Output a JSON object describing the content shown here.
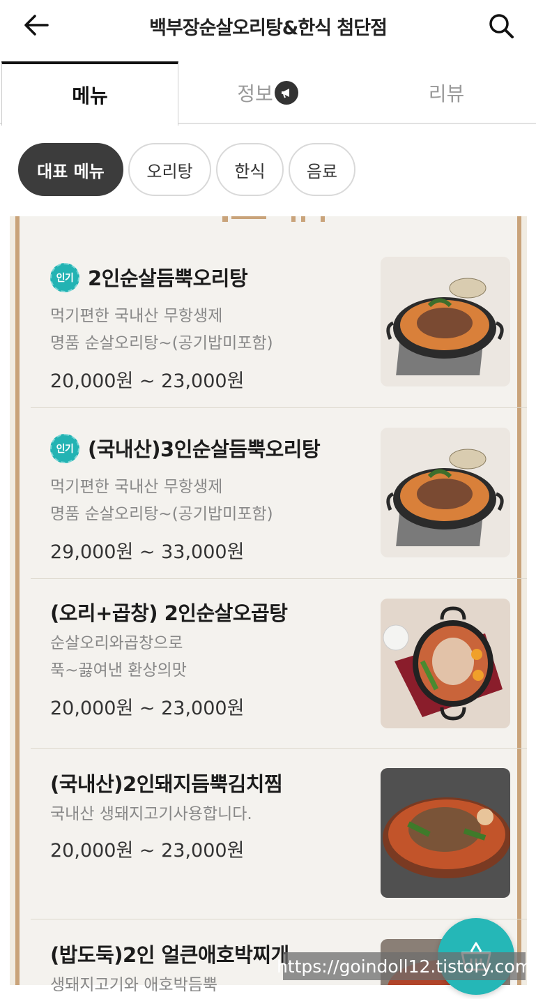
{
  "header": {
    "title": "백부장순살오리탕&한식 첨단점",
    "back_icon": "arrow-left-icon",
    "search_icon": "search-icon"
  },
  "tabs": [
    {
      "label": "메뉴",
      "active": true
    },
    {
      "label": "정보",
      "icon": "megaphone-icon"
    },
    {
      "label": "리뷰"
    }
  ],
  "chips": [
    {
      "label": "대표 메뉴",
      "active": true
    },
    {
      "label": "오리탕"
    },
    {
      "label": "한식"
    },
    {
      "label": "음료"
    }
  ],
  "badge_label": "인기",
  "items": [
    {
      "name": "2인순살듬뿍오리탕",
      "popular": true,
      "desc1": "먹기편한 국내산 무항생제",
      "desc2": "명품 순살오리탕~(공기밥미포함)",
      "price": "20,000원 ~ 23,000원",
      "image": "duck-stew-pot"
    },
    {
      "name": "(국내산)3인순살듬뿍오리탕",
      "popular": true,
      "desc1": "먹기편한 국내산 무항생제",
      "desc2": "명품 순살오리탕~(공기밥미포함)",
      "price": "29,000원 ~ 33,000원",
      "image": "duck-stew-pot"
    },
    {
      "name": "(오리+곱창) 2인순살오곱탕",
      "popular": false,
      "desc1": "순살오리와곱창으로",
      "desc2": "푹~끓여낸 환상의맛",
      "price": "20,000원 ~ 23,000원",
      "image": "duck-tripe-pot"
    },
    {
      "name": "(국내산)2인돼지듬뿍김치찜",
      "popular": false,
      "desc1": "국내산 생돼지고기사용합니다.",
      "desc2": "",
      "price": "20,000원 ~ 23,000원",
      "image": "kimchi-jjim-bowl"
    },
    {
      "name": "(밥도둑)2인 얼큰애호박찌개",
      "popular": false,
      "desc1": "생돼지고기와 애호박듬뿍",
      "desc2": "",
      "price": "",
      "image": "zucchini-stew"
    }
  ],
  "cart_icon": "cart-basket-icon",
  "watermark": "https://goindoll12.tistory.com",
  "colors": {
    "accent": "#25b7b7",
    "chip_active": "#3c3c3c",
    "border_gold": "#c9a37a"
  }
}
